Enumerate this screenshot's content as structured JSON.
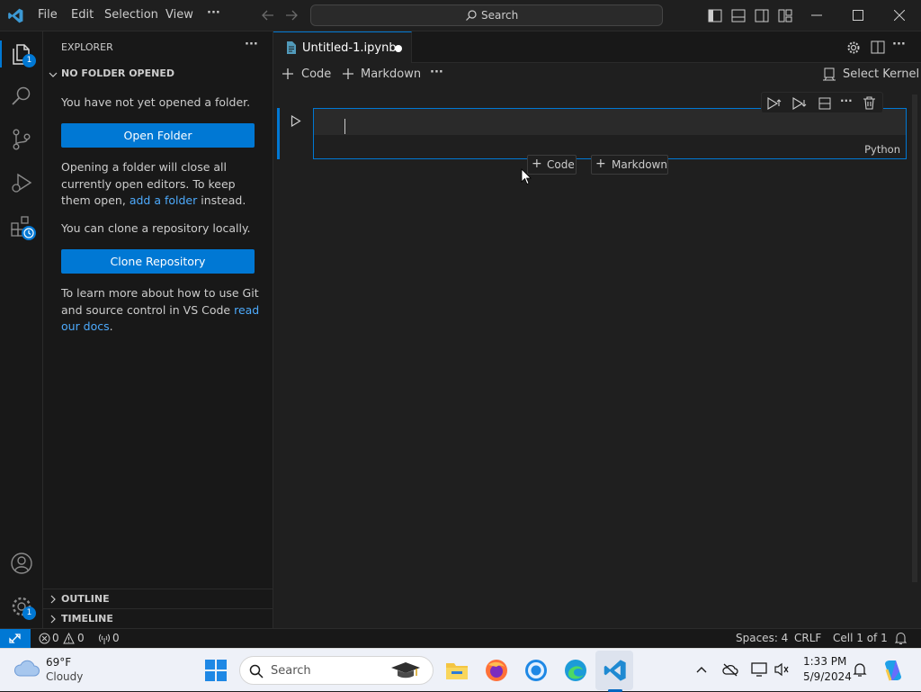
{
  "titlebar": {
    "menu": [
      "File",
      "Edit",
      "Selection",
      "View"
    ],
    "more": "···",
    "search_label": "Search"
  },
  "activitybar": {
    "explorer_badge": "1",
    "settings_badge": "1"
  },
  "sidebar": {
    "title": "EXPLORER",
    "more": "···",
    "section": "NO FOLDER OPENED",
    "msg1": "You have not yet opened a folder.",
    "open_folder": "Open Folder",
    "msg2_a": "Opening a folder will close all currently open editors. To keep them open,",
    "msg2_link": "add a folder",
    "msg2_b": "instead.",
    "msg3": "You can clone a repository locally.",
    "clone_repo": "Clone Repository",
    "msg4_a": "To learn more about how to use Git and source control in VS Code",
    "msg4_link": "read our docs",
    "msg4_b": ".",
    "outline": "OUTLINE",
    "timeline": "TIMELINE"
  },
  "editor": {
    "tab_label": "Untitled-1.ipynb",
    "toolbar": {
      "code": "Code",
      "markdown": "Markdown",
      "more": "···",
      "select_kernel": "Select Kernel"
    },
    "cell": {
      "language": "Python",
      "add_code": "Code",
      "add_markdown": "Markdown"
    }
  },
  "statusbar": {
    "errors": "0",
    "warnings": "0",
    "ports": "0",
    "spaces": "Spaces: 4",
    "eol": "CRLF",
    "cell": "Cell 1 of 1"
  },
  "taskbar": {
    "temp": "69°F",
    "weather": "Cloudy",
    "search": "Search",
    "time": "1:33 PM",
    "date": "5/9/2024"
  },
  "colors": {
    "accent": "#0078d4",
    "link": "#4daafc",
    "background": "#1f1f1f",
    "sidebar": "#181818"
  }
}
